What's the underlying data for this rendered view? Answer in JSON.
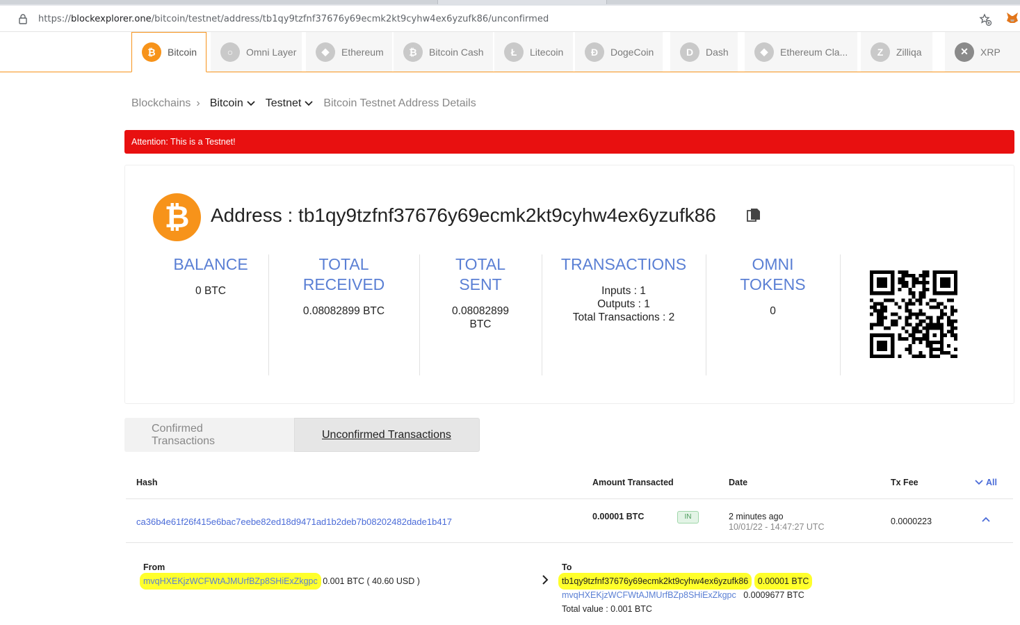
{
  "browser": {
    "url_prefix": "https://",
    "url_host": "blockexplorer.one",
    "url_path": "/bitcoin/testnet/address/tb1qy9tzfnf37676y69ecmk2kt9cyhw4ex6yzufk86/unconfirmed"
  },
  "coin_tabs": [
    {
      "label": "Bitcoin",
      "icon": "bitcoin-icon",
      "glyph": "₿"
    },
    {
      "label": "Omni Layer",
      "icon": "omni-icon",
      "glyph": "○"
    },
    {
      "label": "Ethereum",
      "icon": "ethereum-icon",
      "glyph": "◆"
    },
    {
      "label": "Bitcoin Cash",
      "icon": "bitcoin-cash-icon",
      "glyph": "₿"
    },
    {
      "label": "Litecoin",
      "icon": "litecoin-icon",
      "glyph": "Ł"
    },
    {
      "label": "DogeCoin",
      "icon": "dogecoin-icon",
      "glyph": "Ð"
    },
    {
      "label": "Dash",
      "icon": "dash-icon",
      "glyph": "D"
    },
    {
      "label": "Ethereum Cla...",
      "icon": "ethereum-classic-icon",
      "glyph": "◆"
    },
    {
      "label": "Zilliqa",
      "icon": "zilliqa-icon",
      "glyph": "Z"
    },
    {
      "label": "XRP",
      "icon": "xrp-icon",
      "glyph": "✕"
    }
  ],
  "breadcrumb": {
    "root": "Blockchains",
    "chain": "Bitcoin",
    "network": "Testnet",
    "current": "Bitcoin Testnet Address Details"
  },
  "alert": "Attention: This is a Testnet!",
  "address": {
    "title": "Address : tb1qy9tzfnf37676y69ecmk2kt9cyhw4ex6yzufk86",
    "coin_glyph": "₿"
  },
  "stats": {
    "balance_label": "BALANCE",
    "balance_value": "0 BTC",
    "received_label_1": "TOTAL",
    "received_label_2": "RECEIVED",
    "received_value": "0.08082899 BTC",
    "sent_label_1": "TOTAL",
    "sent_label_2": "SENT",
    "sent_value_1": "0.08082899",
    "sent_value_2": "BTC",
    "tx_label": "TRANSACTIONS",
    "inputs": "Inputs : 1",
    "outputs": "Outputs : 1",
    "total_tx": "Total Transactions : 2",
    "omni_label_1": "OMNI",
    "omni_label_2": "TOKENS",
    "omni_value": "0"
  },
  "tabs": {
    "confirmed": "Confirmed Transactions",
    "unconfirmed": "Unconfirmed Transactions"
  },
  "table": {
    "headers": {
      "hash": "Hash",
      "amount": "Amount Transacted",
      "date": "Date",
      "fee": "Tx Fee",
      "all": "All"
    },
    "row": {
      "hash": "ca36b4e61f26f415e6bac7eebe82ed18d9471ad1b2deb7b08202482dade1b417",
      "amount": "0.00001 BTC",
      "direction": "IN",
      "date_relative": "2 minutes ago",
      "date_abs": "10/01/22 - 14:47:27 UTC",
      "fee": "0.0000223"
    }
  },
  "details": {
    "from_label": "From",
    "from_addr": "mvqHXEKjzWCFWtAJMUrfBZp8SHiExZkgpc",
    "from_amount": "0.001 BTC ( 40.60 USD )",
    "to_label": "To",
    "to_addr_1": "tb1qy9tzfnf37676y69ecmk2kt9cyhw4ex6yzufk86",
    "to_amount_1": "0.00001 BTC",
    "to_addr_2": "mvqHXEKjzWCFWtAJMUrfBZp8SHiExZkgpc",
    "to_amount_2": "0.0009677 BTC",
    "total_value": "Total value : 0.001 BTC"
  },
  "colors": {
    "accent": "#f7931a",
    "link": "#5a7fd4",
    "alert": "#e81010",
    "highlight": "#ffff2b"
  }
}
